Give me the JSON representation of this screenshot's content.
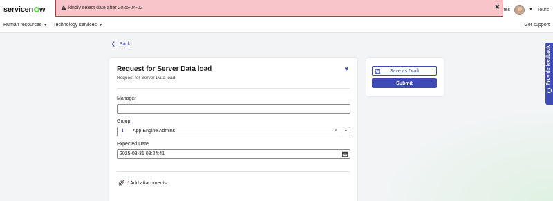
{
  "header": {
    "logo_text_before": "servicen",
    "logo_text_after": "w",
    "favorites_partial": "tes",
    "tours_label": "Tours"
  },
  "alert": {
    "message": "kindly select date after 2025-04-02",
    "close_glyph": "✖",
    "icon": "warning-icon"
  },
  "nav": {
    "items": [
      {
        "label": "Human resources"
      },
      {
        "label": "Technology services"
      }
    ],
    "support_label": "Get support"
  },
  "back_label": "Back",
  "form": {
    "title": "Request for Server Data load",
    "subtitle": "Request for Server Data load",
    "manager": {
      "label": "Manager",
      "value": ""
    },
    "group": {
      "label": "Group",
      "value": "App Engine Admins"
    },
    "expected_date": {
      "label": "Expected Date",
      "value": "2025-03-31 03:24:41"
    },
    "attachments_label": "Add attachments"
  },
  "actions": {
    "save_draft_label": "Save as Draft",
    "submit_label": "Submit"
  },
  "feedback_label": "Provide feedback",
  "colors": {
    "accent": "#3f4bb5",
    "alert_bg": "#f7c5ca",
    "alert_border": "#c8323c",
    "logo_o": "#62d84e"
  }
}
